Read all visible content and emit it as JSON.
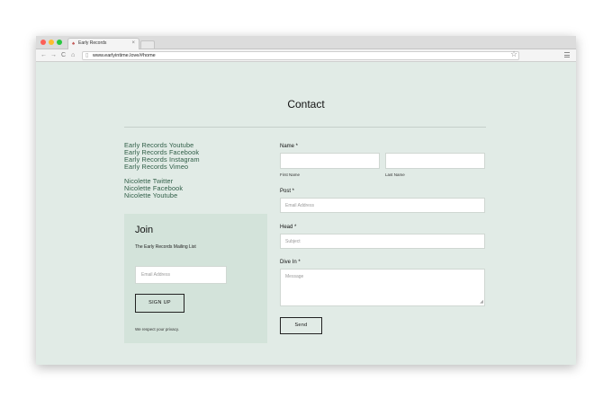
{
  "browser": {
    "tab_title": "Early Records",
    "tab_close": "×",
    "url_host": "www.earlyintime.love/",
    "url_hash": "#home",
    "back_glyph": "←",
    "forward_glyph": "→",
    "reload_glyph": "C",
    "home_glyph": "⌂",
    "page_glyph": "▯",
    "star_glyph": "☆",
    "favicon_glyph": "♠"
  },
  "page": {
    "title": "Contact"
  },
  "links": {
    "group1": [
      "Early Records Youtube",
      "Early Records Facebook",
      "Early Records Instagram",
      "Early Records Vimeo"
    ],
    "group2": [
      "Nicolette Twitter",
      "Nicolette Facebook",
      "Nicolette Youtube"
    ],
    "color": "#2e5d46"
  },
  "join": {
    "title": "Join",
    "subtitle": "The Early Records Mailing List",
    "email_placeholder": "Email Address",
    "signup_label": "SIGN UP",
    "privacy_note": "We respect your privacy.",
    "background": "#d3e3da"
  },
  "form": {
    "name_label": "Name *",
    "first_name_label": "First Name",
    "last_name_label": "Last Name",
    "post_label": "Post *",
    "post_placeholder": "Email Address",
    "head_label": "Head *",
    "head_placeholder": "Subject",
    "dive_label": "Dive In *",
    "dive_placeholder": "Message",
    "send_label": "Send"
  },
  "colors": {
    "page_background": "#e1ebe6"
  }
}
